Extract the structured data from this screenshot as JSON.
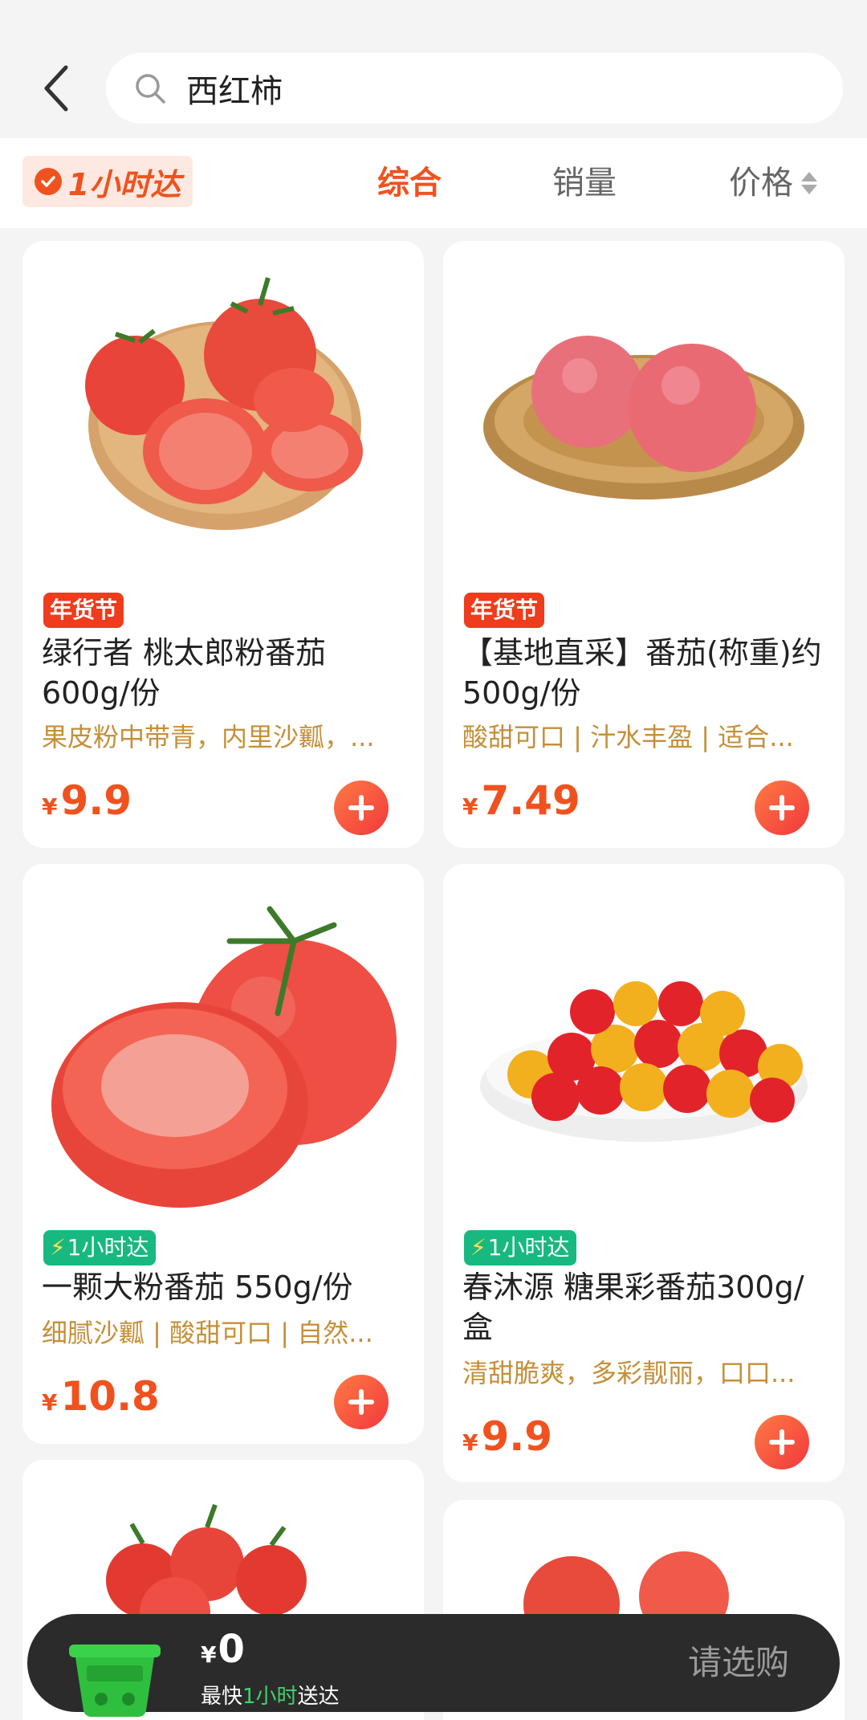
{
  "search": {
    "value": "西红柿"
  },
  "filters": {
    "badge": "1小时达",
    "tabs": [
      {
        "label": "综合",
        "active": true
      },
      {
        "label": "销量",
        "active": false
      },
      {
        "label": "价格",
        "active": false
      }
    ]
  },
  "products": [
    {
      "tag": "年货节",
      "title": "绿行者 桃太郎粉番茄600g/份",
      "desc": "果皮粉中带青，内里沙瓤，...",
      "currency": "¥",
      "price": "9.9",
      "image": "sliced-tomatoes-on-plate"
    },
    {
      "tag": "年货节",
      "title": "【基地直采】番茄(称重)约500g/份",
      "desc": "酸甜可口 | 汁水丰盈 | 适合...",
      "currency": "¥",
      "price": "7.49",
      "image": "pink-tomatoes-in-basket"
    },
    {
      "tag": "1小时达",
      "title": "一颗大粉番茄 550g/份",
      "desc": "细腻沙瓤 | 酸甜可口 | 自然...",
      "currency": "¥",
      "price": "10.8",
      "image": "halved-large-tomato"
    },
    {
      "tag": "1小时达",
      "title": "春沐源 糖果彩番茄300g/盒",
      "desc": "清甜脆爽，多彩靓丽，口口...",
      "currency": "¥",
      "price": "9.9",
      "image": "cherry-tomatoes-bowl"
    }
  ],
  "cart": {
    "currency": "¥",
    "amount": "0",
    "delivery_prefix": "最快",
    "delivery_highlight": "1小时",
    "delivery_suffix": "送达",
    "checkout_label": "请选购"
  },
  "colors": {
    "accent": "#f0521f",
    "tag_red": "#ee3c1d",
    "tag_green": "#17b980",
    "desc": "#c58f38",
    "cart_bar": "#2b2b2b",
    "cart_highlight": "#3fd46a"
  }
}
